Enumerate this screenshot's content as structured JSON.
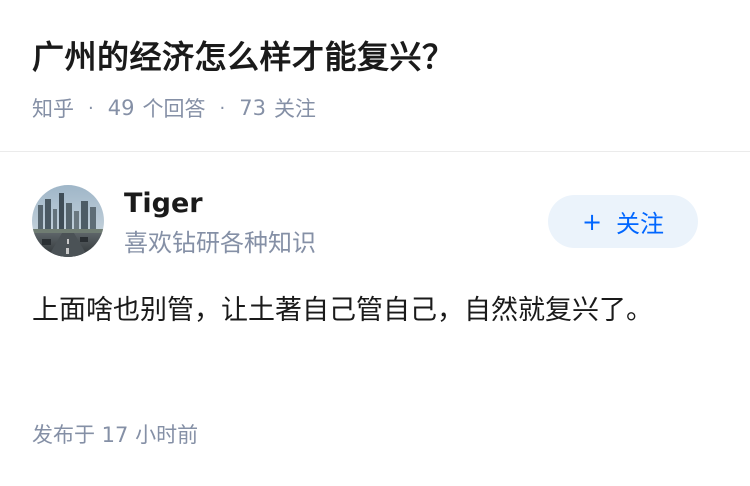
{
  "question": {
    "title": "广州的经济怎么样才能复兴？",
    "source": "知乎",
    "answer_count": "49",
    "answer_label": "个回答",
    "follower_count": "73",
    "follower_label": "关注",
    "separator": "·"
  },
  "author": {
    "name": "Tiger",
    "bio": "喜欢钻研各种知识",
    "follow_icon": "+",
    "follow_label": "关注",
    "accent_color": "#0066ff"
  },
  "answer": {
    "content": "上面啥也别管，让土著自己管自己，自然就复兴了。",
    "time": "发布于 17 小时前"
  }
}
